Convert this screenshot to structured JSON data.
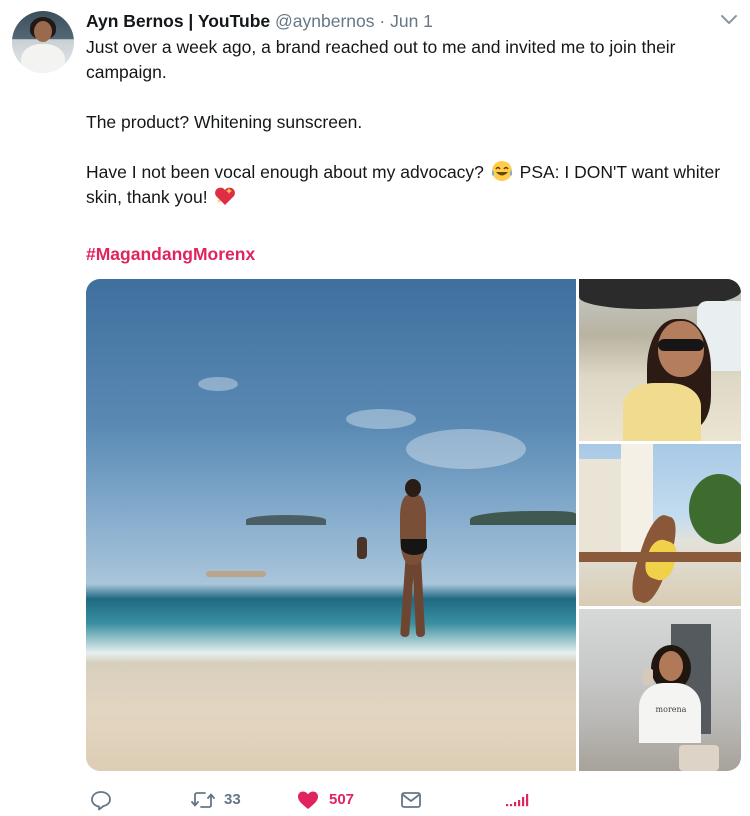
{
  "tweet": {
    "author_name": "Ayn Bernos | YouTube",
    "handle": "@aynbernos",
    "separator": "·",
    "date": "Jun 1",
    "paragraph_1": "Just over a week ago, a brand reached out to me and invited me to join their campaign.",
    "paragraph_2": "The product? Whitening sunscreen.",
    "paragraph_3_before_emoji": "Have I not been vocal enough about my advocacy?",
    "paragraph_3_after_emoji": "PSA: I DON'T want whiter skin, thank you!",
    "hashtag": "#MagandangMorenx",
    "media": {
      "shirt_text": "morena"
    },
    "emojis": [
      "tears-of-joy-emoji",
      "sparkling-heart-emoji"
    ]
  },
  "actions": {
    "retweet_count": "33",
    "like_count": "507"
  },
  "colors": {
    "text": "#14171a",
    "secondary": "#657786",
    "hashtag": "#e0245e",
    "like": "#e0245e",
    "analytics": "#e0245e"
  }
}
